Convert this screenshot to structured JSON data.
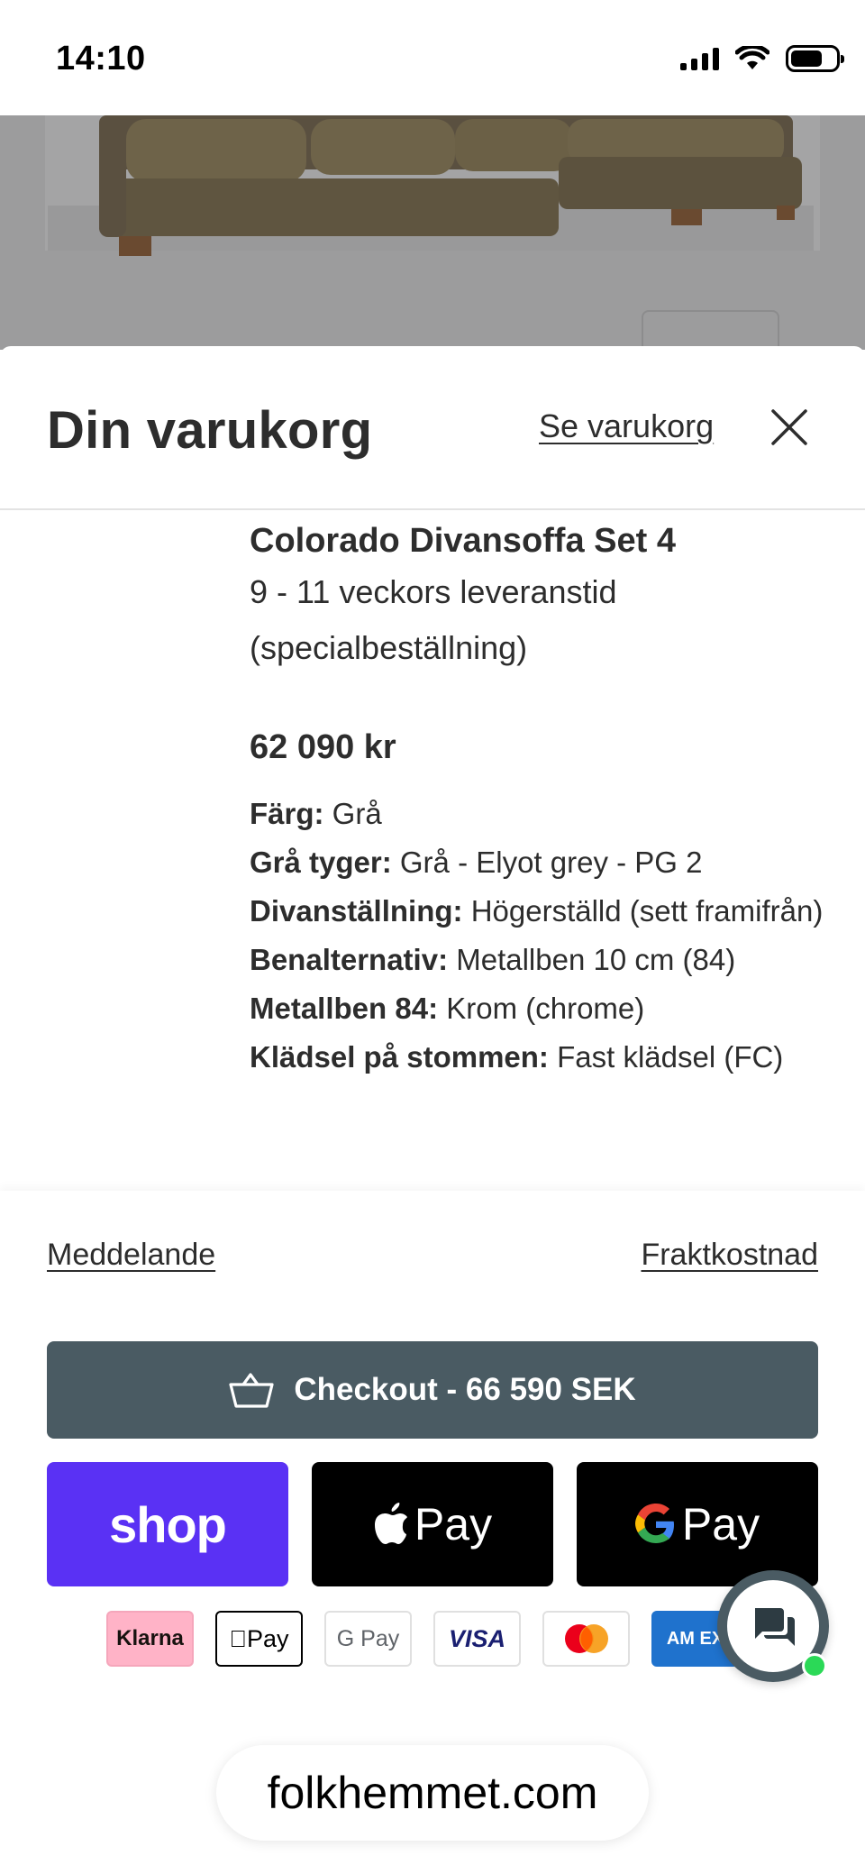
{
  "status_bar": {
    "time": "14:10"
  },
  "cart": {
    "title": "Din varukorg",
    "view_cart_link": "Se varukorg",
    "item": {
      "name": "Colorado Divansoffa Set 4",
      "lead_time": "9 - 11 veckors leveranstid",
      "lead_note": "(specialbeställning)",
      "price": "62 090 kr",
      "options": [
        {
          "label": "Färg:",
          "value": " Grå"
        },
        {
          "label": "Grå tyger:",
          "value": " Grå - Elyot grey - PG 2"
        },
        {
          "label": "Divanställning:",
          "value": " Högerställd (sett framifrån)"
        },
        {
          "label": "Benalternativ:",
          "value": " Metallben 10 cm (84)"
        },
        {
          "label": "Metallben 84:",
          "value": " Krom (chrome)"
        },
        {
          "label": "Klädsel på stommen:",
          "value": " Fast klädsel (FC)"
        }
      ]
    }
  },
  "footer": {
    "message_link": "Meddelande",
    "shipping_link": "Fraktkostnad",
    "checkout_label": "Checkout - 66 590 SEK",
    "shop_pay_label": "shop",
    "apple_pay_label": "Pay",
    "google_pay_label": "Pay",
    "cards": {
      "klarna": "Klarna",
      "apple_pay": "Pay",
      "google_pay": "G Pay",
      "visa": "VISA",
      "amex": "AM EX"
    }
  },
  "browser": {
    "url": "folkhemmet.com"
  },
  "colors": {
    "checkout_bg": "#4a5b63",
    "shop_pay_bg": "#5a31f4",
    "online_dot": "#2bd957"
  }
}
